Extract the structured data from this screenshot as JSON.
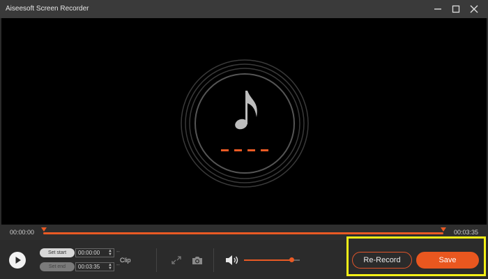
{
  "window": {
    "title": "Aiseesoft Screen Recorder",
    "controls": [
      "minimize-icon",
      "maximize-icon",
      "close-icon"
    ]
  },
  "timeline": {
    "start_time": "00:00:00",
    "end_time": "00:03:35",
    "progress_fraction": 1.0
  },
  "clip": {
    "set_start_label": "Set start",
    "set_end_label": "Set end",
    "start_value": "00:00:00",
    "end_value": "00:03:35",
    "separator": "--",
    "clip_label": "Clip"
  },
  "tools": {
    "icons": [
      "expand-icon",
      "camera-icon",
      "volume-icon"
    ]
  },
  "volume": {
    "level_fraction": 0.85
  },
  "actions": {
    "rerecord_label": "Re-Record",
    "save_label": "Save"
  },
  "colors": {
    "accent": "#e9571f",
    "highlight": "#f3ef17",
    "background": "#2b2b2b",
    "preview": "#000000"
  }
}
